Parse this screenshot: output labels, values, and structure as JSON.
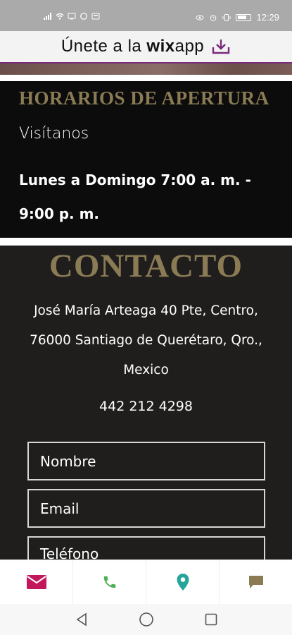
{
  "status_bar": {
    "time": "12:29"
  },
  "banner": {
    "text_prefix": "Únete a la ",
    "text_brand": "wix",
    "text_suffix": "app",
    "icon": "download-icon",
    "accent_color": "#7a2a7a"
  },
  "hours": {
    "title": "HORARIOS DE APERTURA",
    "subtitle": "Visítanos",
    "schedule": "Lunes a Domingo 7:00 a. m. - 9:00 p. m."
  },
  "contact": {
    "title": "CONTACTO",
    "address": "José María Arteaga 40 Pte, Centro, 76000 Santiago de Querétaro, Qro., Mexico",
    "phone": "442 212 4298",
    "form": {
      "name_placeholder": "Nombre",
      "email_placeholder": "Email",
      "phone_placeholder": "Teléfono"
    }
  },
  "action_bar": {
    "items": [
      {
        "icon": "mail-icon",
        "color": "#c2185b"
      },
      {
        "icon": "phone-icon",
        "color": "#4caf50"
      },
      {
        "icon": "location-icon",
        "color": "#26a69a"
      },
      {
        "icon": "chat-icon",
        "color": "#8a7b55"
      }
    ]
  },
  "colors": {
    "gold": "#8a7b55",
    "hours_bg": "#0c0c0c",
    "contact_bg": "#1f1e1d"
  }
}
